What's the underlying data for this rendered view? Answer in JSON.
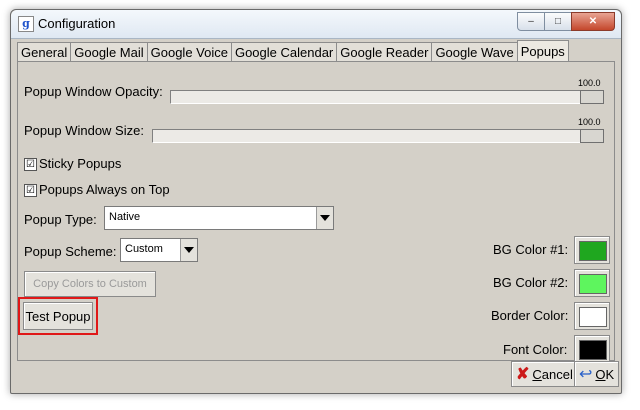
{
  "window": {
    "title": "Configuration",
    "app_icon": "g",
    "min": "–",
    "max": "□",
    "close": "✕"
  },
  "tabs": [
    "General",
    "Google Mail",
    "Google Voice",
    "Google Calendar",
    "Google Reader",
    "Google Wave",
    "Popups"
  ],
  "active_tab": "Popups",
  "opacity": {
    "label": "Popup Window Opacity:",
    "value": "100.0",
    "fraction": 1.0
  },
  "size": {
    "label": "Popup Window Size:",
    "value": "100.0",
    "fraction": 1.0
  },
  "sticky": {
    "label": "Sticky Popups",
    "checked": true,
    "mark": "☑"
  },
  "always_on_top": {
    "label": "Popups Always on Top",
    "checked": true,
    "mark": "☑"
  },
  "popup_type": {
    "label": "Popup Type:",
    "value": "Native"
  },
  "popup_scheme": {
    "label": "Popup Scheme:",
    "value": "Custom"
  },
  "copy_colors": {
    "label": "Copy Colors to Custom"
  },
  "test_popup": {
    "label": "Test Popup"
  },
  "colors": {
    "bg1": {
      "label": "BG Color #1:",
      "color": "#1fa71f"
    },
    "bg2": {
      "label": "BG Color #2:",
      "color": "#5ef55e"
    },
    "border": {
      "label": "Border Color:",
      "color": "#ffffff"
    },
    "font": {
      "label": "Font Color:",
      "color": "#000000"
    }
  },
  "footer": {
    "cancel_mnemonic": "C",
    "cancel_rest": "ancel",
    "ok_mnemonic": "O",
    "ok_rest": "K"
  },
  "accent_highlight": "#e01818"
}
